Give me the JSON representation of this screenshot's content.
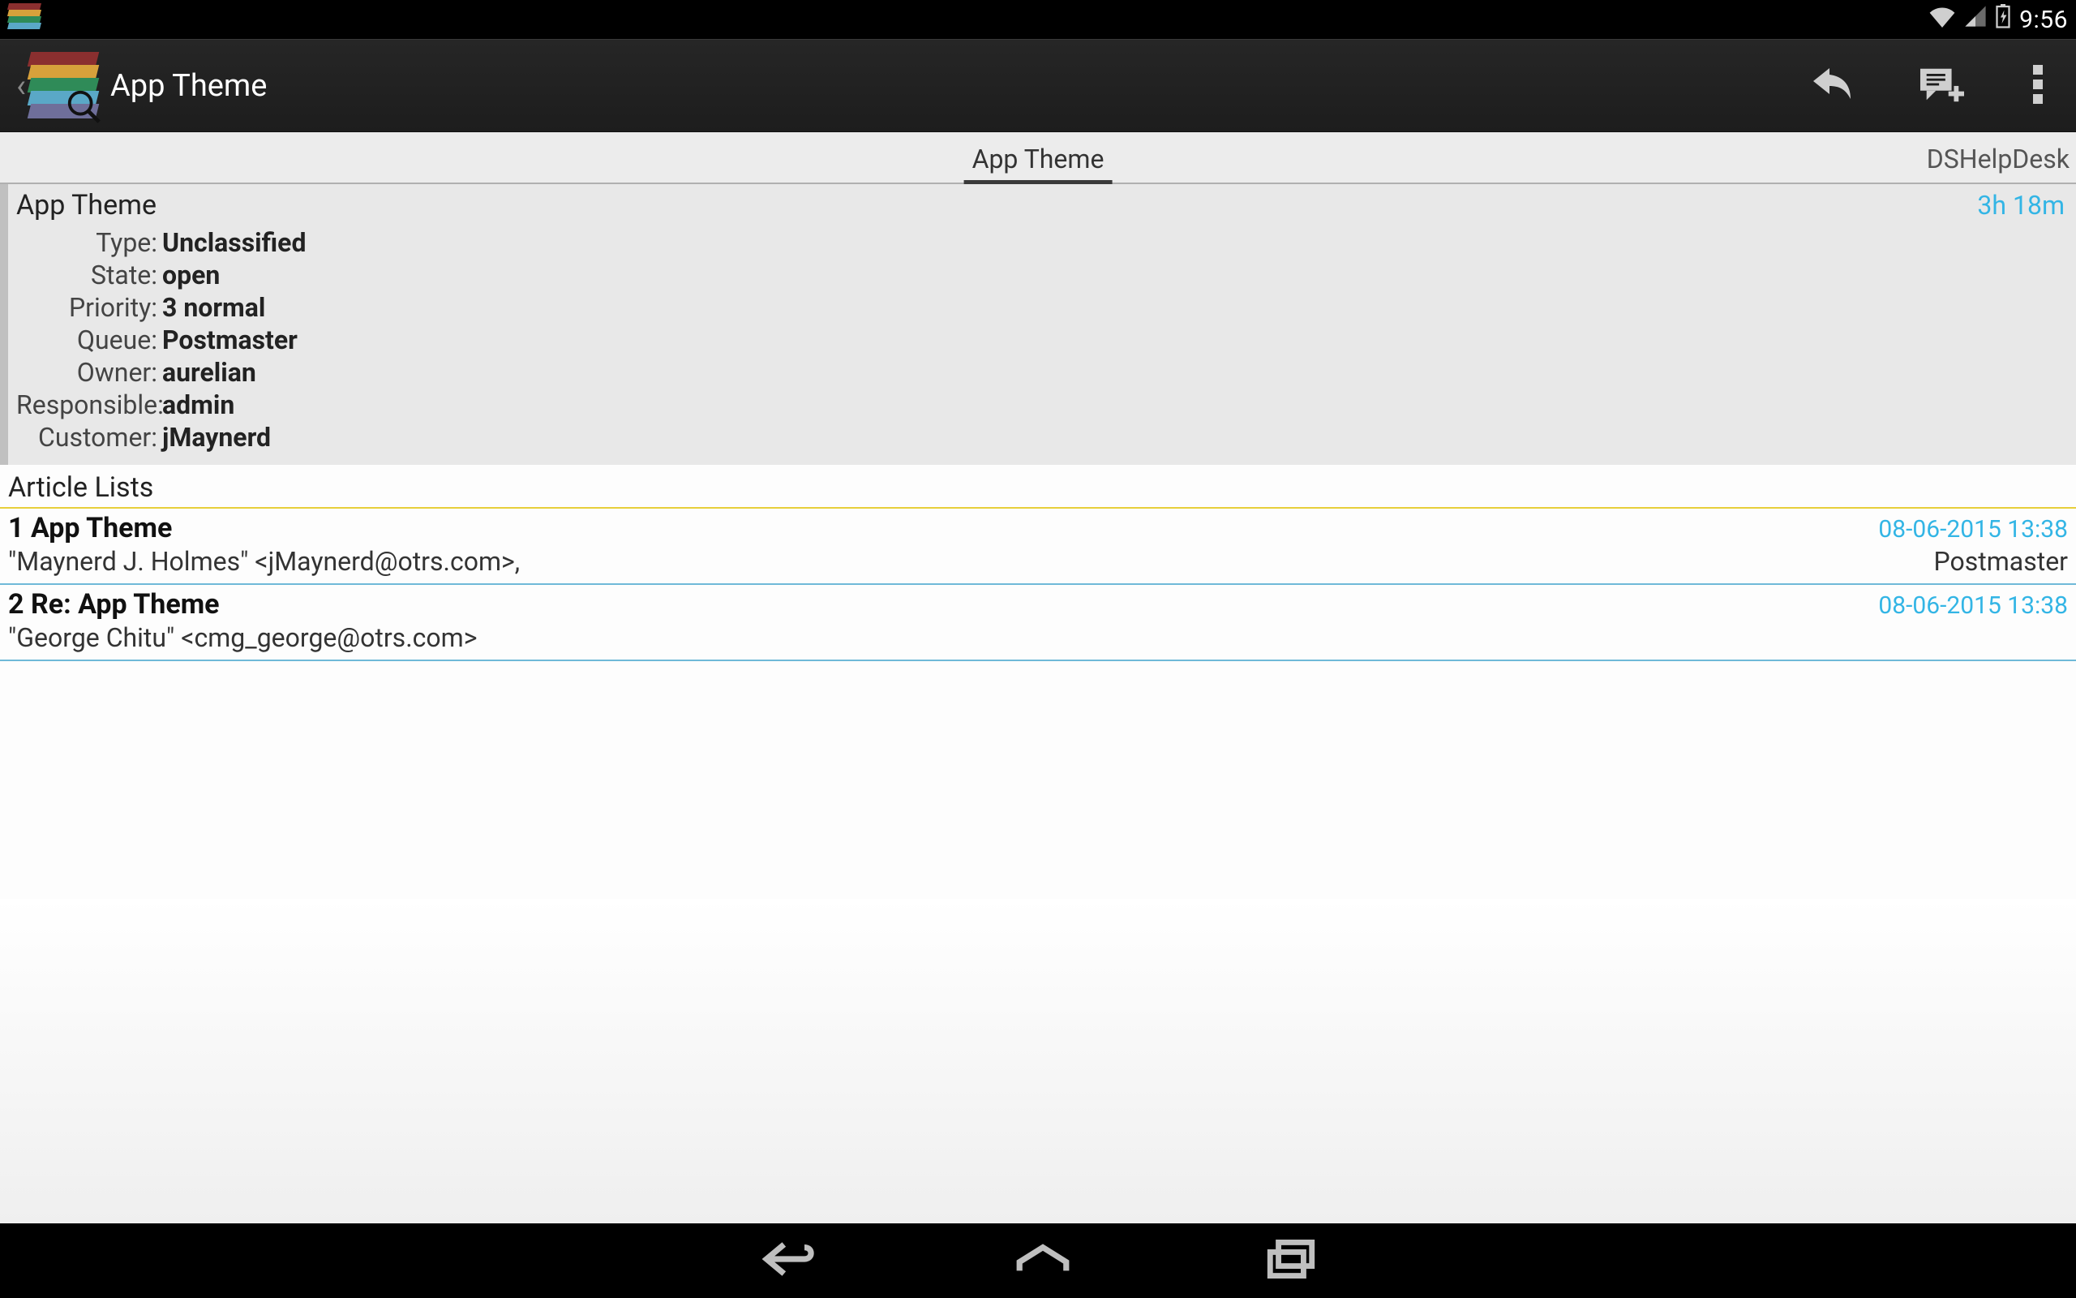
{
  "status_bar": {
    "time": "9:56"
  },
  "action_bar": {
    "title": "App Theme"
  },
  "tabs": {
    "active": "App Theme",
    "right": "DSHelpDesk"
  },
  "ticket": {
    "title": "App Theme",
    "age": "3h  18m",
    "props": {
      "type_k": "Type:",
      "type_v": "Unclassified",
      "state_k": "State:",
      "state_v": "open",
      "priority_k": "Priority:",
      "priority_v": "3 normal",
      "queue_k": "Queue:",
      "queue_v": "Postmaster",
      "owner_k": "Owner:",
      "owner_v": "aurelian",
      "responsible_k": "Responsible:",
      "responsible_v": "admin",
      "customer_k": "Customer:",
      "customer_v": "jMaynerd"
    }
  },
  "articles": {
    "header": "Article Lists",
    "items": [
      {
        "title": "1 App Theme",
        "date": "08-06-2015 13:38",
        "from": "\"Maynerd J. Holmes\" <jMaynerd@otrs.com>,",
        "extra": "Postmaster"
      },
      {
        "title": "2 Re: App Theme",
        "date": "08-06-2015 13:38",
        "from": "\"George Chitu\" <cmg_george@otrs.com>",
        "extra": ""
      }
    ]
  }
}
